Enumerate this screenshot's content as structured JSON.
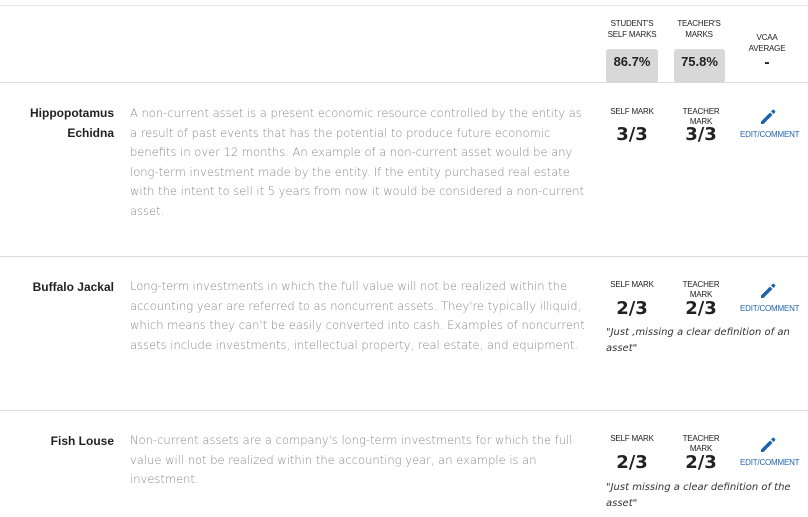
{
  "header": {
    "student_self_marks_label": "STUDENT'S SELF MARKS",
    "teacher_marks_label": "TEACHER'S MARKS",
    "vcaa_average_label": "VCAA AVERAGE",
    "student_self_marks_value": "86.7%",
    "teacher_marks_value": "75.8%",
    "vcaa_average_value": "-"
  },
  "labels": {
    "self_mark": "SELF MARK",
    "teacher_mark": "TEACHER MARK",
    "edit_comment": "EDIT/COMMENT"
  },
  "rows": [
    {
      "student": "Hippopotamus Echidna",
      "answer": "A non-current asset is a present economic resource controlled by the entity as a result of past events that has the potential to produce future economic benefits in over 12 months. An example of a non-current asset would be any long-term investment made by the entity. If the entity purchased real estate with the intent to sell it 5 years from now it would be considered a non-current asset.",
      "self_mark": "3/3",
      "teacher_mark": "3/3",
      "comment": ""
    },
    {
      "student": "Buffalo Jackal",
      "answer": "Long-term investments in which the full value will not be realized within the accounting year are referred to as noncurrent assets. They're typically illiquid, which means they can't be easily converted into cash. Examples of noncurrent assets include investments, intellectual property, real estate, and equipment.",
      "self_mark": "2/3",
      "teacher_mark": "2/3",
      "comment": "\"Just ,missing a clear definition of an asset\""
    },
    {
      "student": "Fish Louse",
      "answer": "Non-current assets are a company's long-term investments for which the full value will not be realized within the accounting year, an example is an investment.",
      "self_mark": "2/3",
      "teacher_mark": "2/3",
      "comment": "\"Just missing a clear definition of the asset\""
    }
  ],
  "colors": {
    "accent": "#1e64a8",
    "pill_bg": "#d8d8d8",
    "answer_text": "#8a8a8a"
  },
  "icons": {
    "edit": "pencil-icon"
  }
}
